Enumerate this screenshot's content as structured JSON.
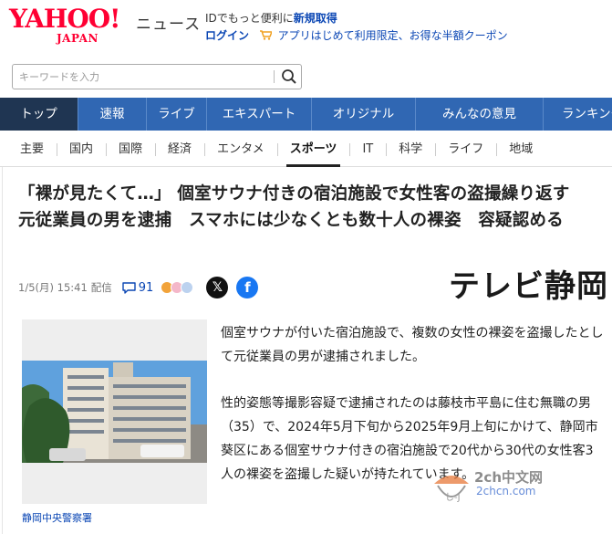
{
  "header": {
    "logo_text": "YAHOO!",
    "logo_sub": "JAPAN",
    "service_name": "ニュース",
    "promo_prefix": "IDでもっと便利に",
    "promo_strong": "新規取得",
    "login_label": "ログイン",
    "promo_line2": "アプリはじめて利用限定、お得な半額クーポン"
  },
  "search": {
    "placeholder": "キーワードを入力"
  },
  "nav_primary": [
    {
      "label": "トップ",
      "active": true
    },
    {
      "label": "速報",
      "active": false
    },
    {
      "label": "ライブ",
      "active": false
    },
    {
      "label": "エキスパート",
      "active": false
    },
    {
      "label": "オリジナル",
      "active": false
    },
    {
      "label": "みんなの意見",
      "active": false
    },
    {
      "label": "ランキング",
      "active": false
    }
  ],
  "nav_secondary": [
    {
      "label": "主要",
      "active": false
    },
    {
      "label": "国内",
      "active": false
    },
    {
      "label": "国際",
      "active": false
    },
    {
      "label": "経済",
      "active": false
    },
    {
      "label": "エンタメ",
      "active": false
    },
    {
      "label": "スポーツ",
      "active": true
    },
    {
      "label": "IT",
      "active": false
    },
    {
      "label": "科学",
      "active": false
    },
    {
      "label": "ライフ",
      "active": false
    },
    {
      "label": "地域",
      "active": false
    }
  ],
  "article": {
    "headline": "「裸が見たくて…」 個室サウナ付きの宿泊施設で女性客の盗撮繰り返す　元従業員の男を逮捕　スマホには少なくとも数十人の裸姿　容疑認める",
    "date": "1/5(月) 15:41",
    "delivery": "配信",
    "comment_count": "91",
    "publisher": "テレビ静岡",
    "photo_caption": "静岡中央警察署",
    "paragraphs": [
      "個室サウナが付いた宿泊施設で、複数の女性の裸姿を盗撮したとして元従業員の男が逮捕されました。",
      "性的姿態等撮影容疑で逮捕されたのは藤枝市平島に住む無職の男（35）で、2024年5月下旬から2025年9月上旬にかけて、静岡市葵区にある個室サウナ付きの宿泊施設で20代から30代の女性客3人の裸姿を盗撮した疑いが持たれています。"
    ]
  },
  "watermark": {
    "line1": "2ch中文网",
    "line2": "2chcn.com"
  },
  "colors": {
    "brand_red": "#ff0033",
    "nav_blue": "#3067b3",
    "nav_active": "#1f3552",
    "link_blue": "#0a46b4"
  }
}
